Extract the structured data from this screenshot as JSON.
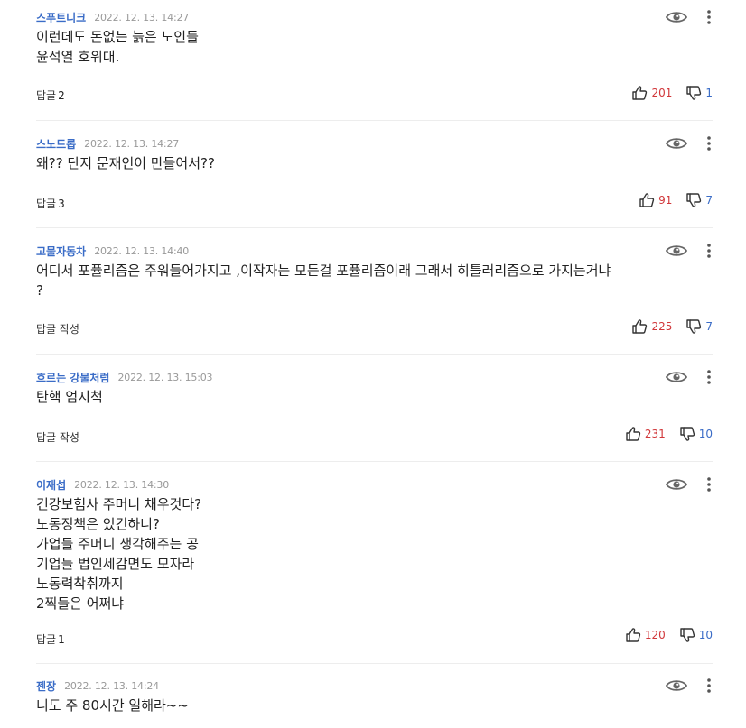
{
  "comments": [
    {
      "nickname": "스푸트니크",
      "date": "2022. 12. 13. 14:27",
      "text": "이런데도 돈없는 늙은 노인들\n윤석열 호위대.",
      "reply_label": "답글",
      "reply_count": "2",
      "likes": "201",
      "dislikes": "1",
      "eye_icon": "eye-icon",
      "more_icon": "kebab-menu-icon"
    },
    {
      "nickname": "스노드롭",
      "date": "2022. 12. 13. 14:27",
      "text": "왜?? 단지 문재인이 만들어서??",
      "reply_label": "답글",
      "reply_count": "3",
      "likes": "91",
      "dislikes": "7"
    },
    {
      "nickname": "고물자동차",
      "date": "2022. 12. 13. 14:40",
      "text": "어디서 포퓰리즘은 주워들어가지고 ,이작자는 모든걸 포퓰리즘이래 그래서 히틀러리즘으로 가지는거냐\n?",
      "reply_label": "답글 작성",
      "reply_count": "",
      "likes": "225",
      "dislikes": "7"
    },
    {
      "nickname": "흐르는 강물처럼",
      "date": "2022. 12. 13. 15:03",
      "text": "탄핵 엄지척",
      "reply_label": "답글 작성",
      "reply_count": "",
      "likes": "231",
      "dislikes": "10"
    },
    {
      "nickname": "이재섭",
      "date": "2022. 12. 13. 14:30",
      "text": "건강보험사 주머니 채우것다?\n노동정책은 있긴하니?\n가업들 주머니 생각해주는 공\n기업들 법인세감면도 모자라\n노동력착취까지\n2찍들은 어쩌냐",
      "reply_label": "답글",
      "reply_count": "1",
      "likes": "120",
      "dislikes": "10"
    },
    {
      "nickname": "젠장",
      "date": "2022. 12. 13. 14:24",
      "text": "니도 주 80시간 일해라~~",
      "reply_label": "",
      "reply_count": "",
      "likes": "",
      "dislikes": ""
    }
  ],
  "colors": {
    "nickname": "#3a6cc7",
    "like": "#d1373a",
    "dislike": "#3a6cc7",
    "icon": "#555555"
  }
}
